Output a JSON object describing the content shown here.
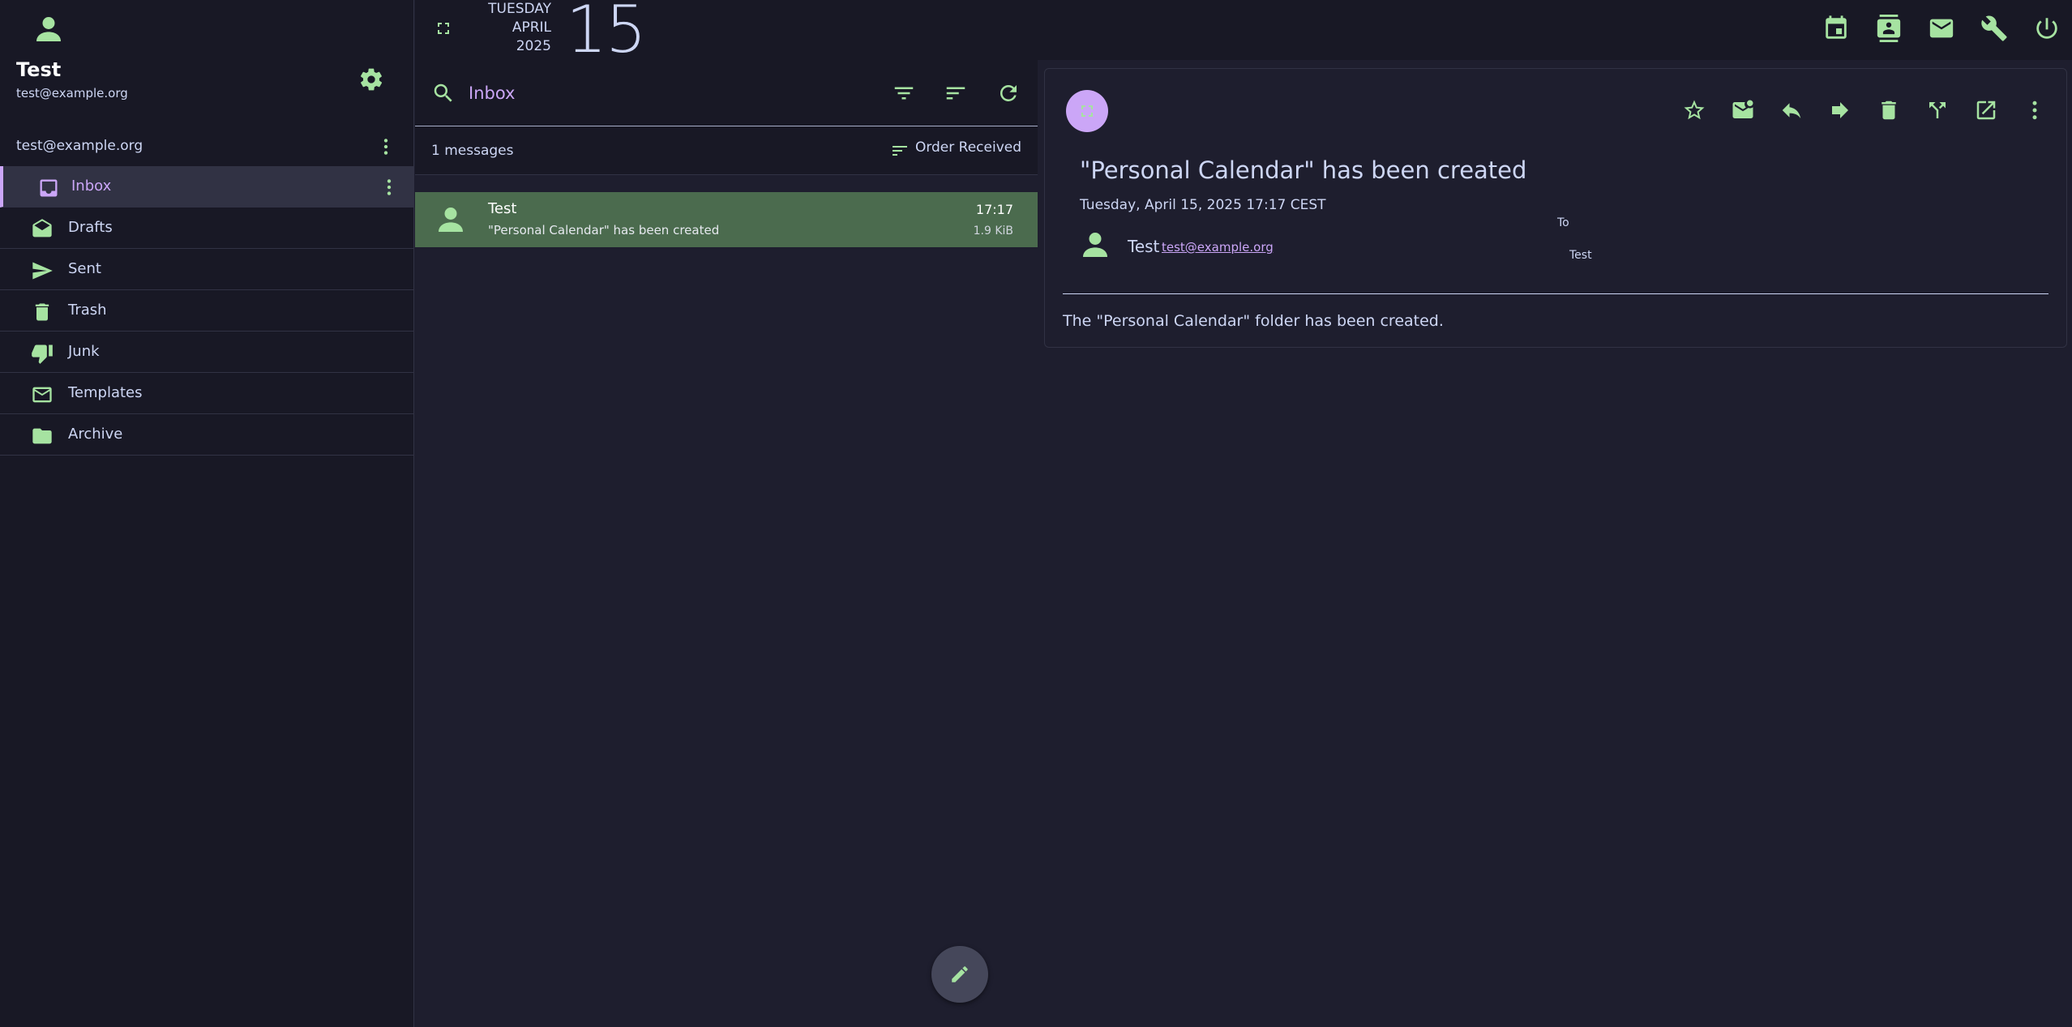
{
  "sidebar": {
    "user_name": "Test",
    "user_email": "test@example.org",
    "account_label": "test@example.org",
    "folders": [
      {
        "label": "Inbox",
        "icon": "inbox-icon",
        "active": true
      },
      {
        "label": "Drafts",
        "icon": "drafts-icon"
      },
      {
        "label": "Sent",
        "icon": "send-icon"
      },
      {
        "label": "Trash",
        "icon": "trash-icon"
      },
      {
        "label": "Junk",
        "icon": "thumb-down-icon"
      },
      {
        "label": "Templates",
        "icon": "mail-icon"
      },
      {
        "label": "Archive",
        "icon": "folder-icon"
      }
    ]
  },
  "header": {
    "weekday": "TUESDAY",
    "month": "APRIL",
    "year": "2025",
    "day": "15"
  },
  "list": {
    "search_value": "Inbox",
    "message_count": "1 messages",
    "order_label": "Order Received",
    "messages": [
      {
        "from": "Test",
        "subject": "\"Personal Calendar\" has been created",
        "time": "17:17",
        "size": "1.9 KiB"
      }
    ]
  },
  "reader": {
    "subject": "\"Personal Calendar\" has been created",
    "date": "Tuesday, April 15, 2025 17:17 CEST",
    "from_name": "Test",
    "from_email": "test@example.org",
    "to_label": "To",
    "to_value": "Test",
    "body": "The \"Personal Calendar\" folder has been created."
  },
  "colors": {
    "accent": "#a6e3a1",
    "highlight": "#cba6f7",
    "selected_row": "#4b6b4e",
    "background": "#1e1e2e",
    "panel": "#181825"
  }
}
